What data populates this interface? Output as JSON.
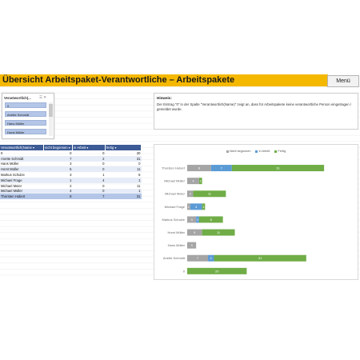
{
  "header": {
    "title": "Übersicht Arbeitspaket-Verantwortliche – Arbeitspakete",
    "menu_label": "Menü"
  },
  "slicer": {
    "title": "Verantwortlich(...",
    "items": [
      "0",
      "Anette Schmidt",
      "Hans Müller",
      "Horst Müller"
    ]
  },
  "hint": {
    "title": "Hinweis:",
    "text": "Der Eintrag \"0\" in der Spalte \"Verantwortlich(Name)\" zeigt an, dass für Arbeitspakete keine verantwortliche Person eingetragen / gemeldet wurde."
  },
  "table": {
    "headers": [
      "Verantwortlich(Name",
      "nicht begonnen",
      "in Arbeit",
      "fertig"
    ],
    "rows": [
      [
        "0",
        "0",
        "0",
        "20"
      ],
      [
        "Anette Schmidt",
        "7",
        "2",
        "31"
      ],
      [
        "Hans Müller",
        "3",
        "0",
        "0"
      ],
      [
        "Horst Müller",
        "5",
        "0",
        "11"
      ],
      [
        "Markus Schulze",
        "3",
        "1",
        "8"
      ],
      [
        "Michael Frage",
        "1",
        "4",
        "1"
      ],
      [
        "Michael Meier",
        "2",
        "0",
        "11"
      ],
      [
        "Michael Müller",
        "4",
        "0",
        "1"
      ],
      [
        "Thorsten Hubert",
        "8",
        "7",
        "31"
      ]
    ]
  },
  "chart_data": {
    "type": "bar",
    "orientation": "horizontal",
    "stacked": true,
    "categories": [
      "Thorsten Hubert",
      "Michael Müller",
      "Michael Meier",
      "Michael Frage",
      "Markus Schulze",
      "Horst Müller",
      "Hans Müller",
      "Anette Schmidt",
      "0"
    ],
    "series": [
      {
        "name": "Nicht begonnen",
        "color": "#a5a5a5",
        "values": [
          8,
          4,
          2,
          1,
          3,
          5,
          3,
          7,
          0
        ]
      },
      {
        "name": "In Arbeit",
        "color": "#5b9bd5",
        "values": [
          7,
          0,
          0,
          4,
          1,
          0,
          0,
          2,
          0
        ]
      },
      {
        "name": "Fertig",
        "color": "#70ad47",
        "values": [
          31,
          1,
          11,
          1,
          8,
          11,
          0,
          31,
          20
        ]
      }
    ],
    "legend_position": "top",
    "grid": false
  }
}
